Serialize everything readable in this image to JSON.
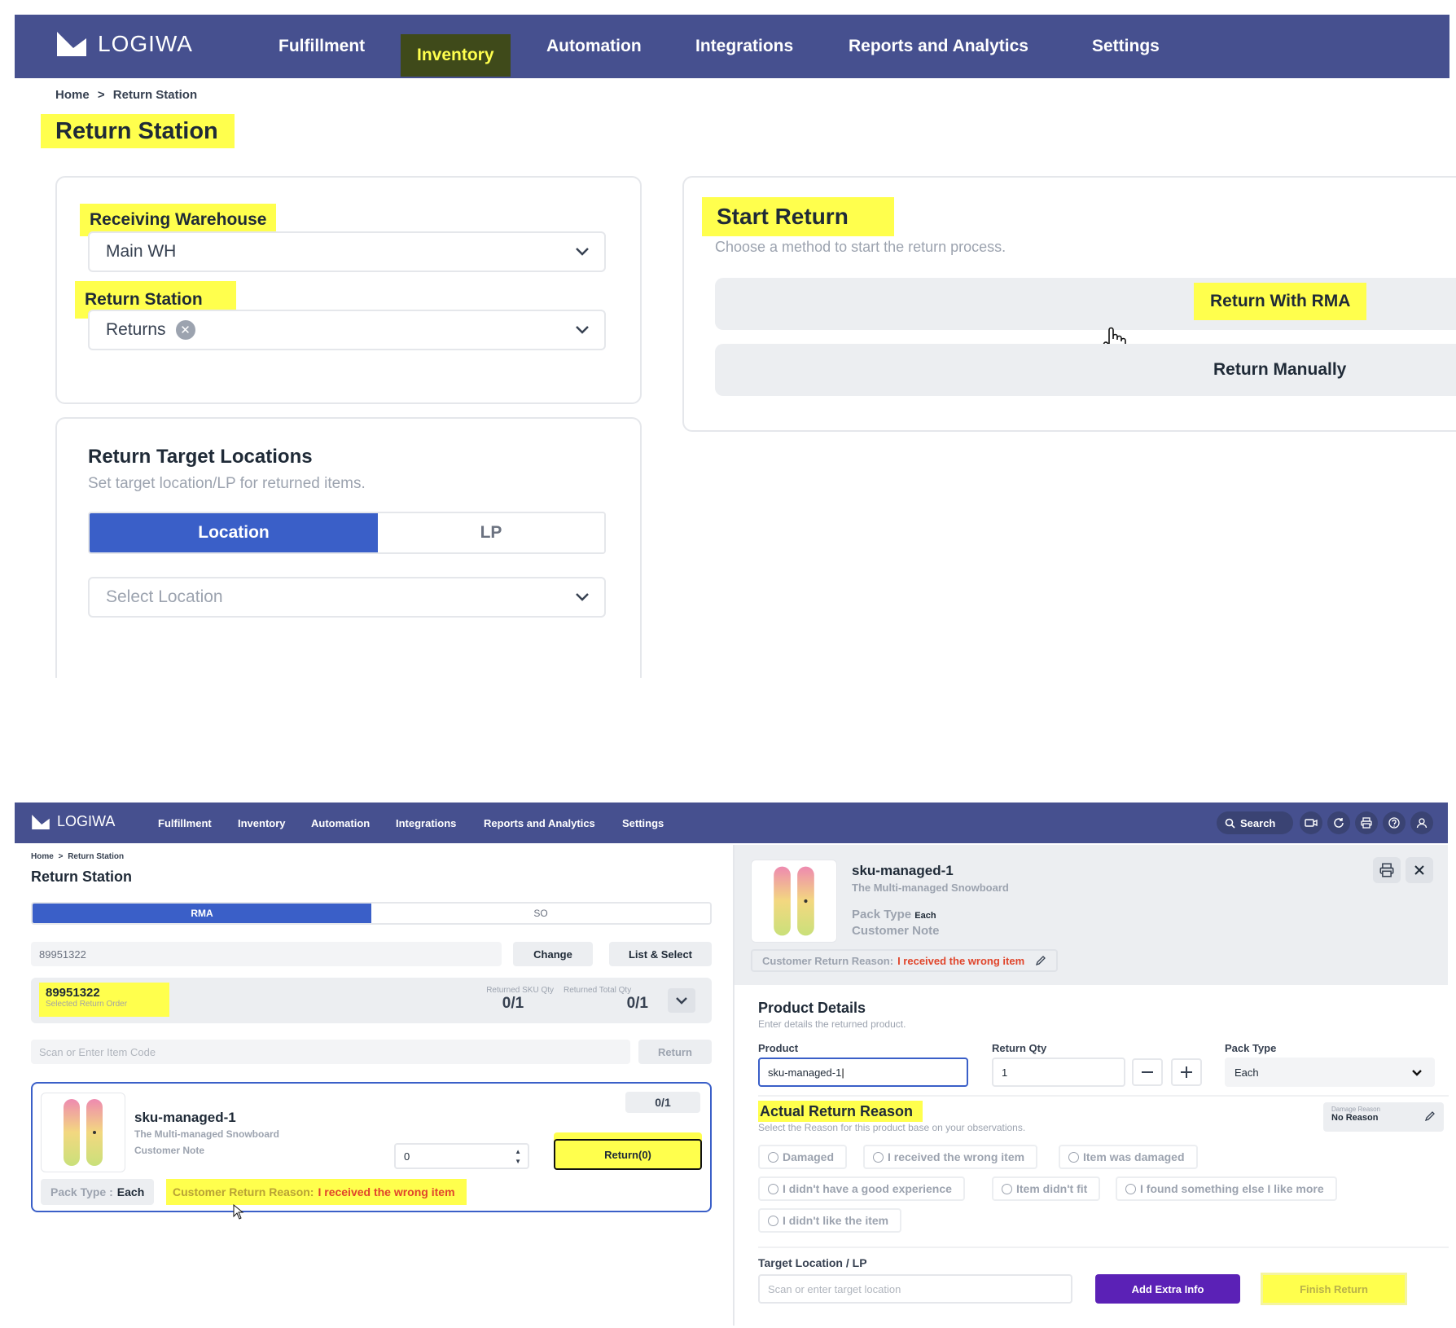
{
  "top": {
    "brand": "LOGIWA",
    "nav": [
      "Fulfillment",
      "Inventory",
      "Automation",
      "Integrations",
      "Reports and Analytics",
      "Settings"
    ],
    "active_nav": "Inventory",
    "breadcrumb": {
      "home": "Home",
      "sep": ">",
      "current": "Return Station"
    },
    "page_title": "Return Station",
    "receiving_warehouse": {
      "label": "Receiving Warehouse",
      "value": "Main WH"
    },
    "return_station": {
      "label": "Return Station",
      "value": "Returns"
    },
    "target": {
      "title": "Return Target Locations",
      "subtitle": "Set target location/LP for returned items.",
      "tab_location": "Location",
      "tab_lp": "LP",
      "select_placeholder": "Select Location"
    },
    "start_return": {
      "title": "Start Return",
      "subtitle": "Choose a method to start the return process.",
      "with_rma": "Return With RMA",
      "manually": "Return Manually"
    }
  },
  "bottom": {
    "brand": "LOGIWA",
    "nav": [
      "Fulfillment",
      "Inventory",
      "Automation",
      "Integrations",
      "Reports and Analytics",
      "Settings"
    ],
    "search_label": "Search",
    "breadcrumb": {
      "home": "Home",
      "sep": ">",
      "current": "Return Station"
    },
    "page_title": "Return Station",
    "tabs": {
      "rma": "RMA",
      "so": "SO"
    },
    "order_input": "89951322",
    "change_btn": "Change",
    "list_select_btn": "List & Select",
    "order": {
      "number": "89951322",
      "caption": "Selected Return Order",
      "sku_qty_label": "Returned SKU Qty",
      "sku_qty": "0/1",
      "total_qty_label": "Returned Total Qty",
      "total_qty": "0/1"
    },
    "scan_placeholder": "Scan or Enter Item Code",
    "return_btn": "Return",
    "item": {
      "sku": "sku-managed-1",
      "name": "The Multi-managed Snowboard",
      "customer_note": "Customer Note",
      "progress": "0/1",
      "qty": "0",
      "return_btn": "Return(0)",
      "pack_type_label": "Pack Type :",
      "pack_type": "Each",
      "reason_label": "Customer Return Reason:",
      "reason": "I received the wrong item"
    },
    "detail": {
      "sku": "sku-managed-1",
      "name": "The Multi-managed Snowboard",
      "pack_type_label": "Pack Type",
      "pack_type": "Each",
      "customer_note": "Customer Note",
      "reason_label": "Customer Return Reason:",
      "reason": "I received the wrong item"
    },
    "product_details": {
      "title": "Product Details",
      "subtitle": "Enter details the returned product.",
      "product_label": "Product",
      "product_value": "sku-managed-1",
      "qty_label": "Return Qty",
      "qty_value": "1",
      "pack_label": "Pack Type",
      "pack_value": "Each"
    },
    "actual_reason": {
      "title": "Actual Return Reason",
      "subtitle": "Select the Reason for this product base on your observations.",
      "damage_label": "Damage Reason",
      "damage_value": "No Reason",
      "options": [
        "Damaged",
        "I received the wrong item",
        "Item was damaged",
        "I didn't have a good experience",
        "Item didn't fit",
        "I found something else I like more",
        "I didn't like the item"
      ]
    },
    "target": {
      "label": "Target Location / LP",
      "placeholder": "Scan or enter target location",
      "extra_btn": "Add Extra Info",
      "finish_btn": "Finish Return"
    }
  },
  "colors": {
    "nav_bg": "#46508f",
    "primary": "#3a5fc8",
    "highlight": "#ffff4d",
    "purple": "#5b21b6",
    "reason_red": "#e0452b"
  }
}
